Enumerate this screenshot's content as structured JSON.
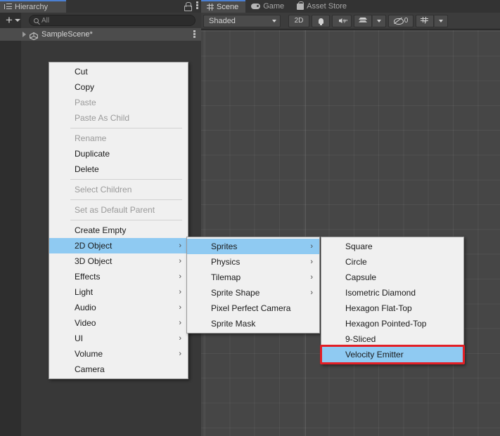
{
  "hierarchy": {
    "tab_label": "Hierarchy",
    "tab_icon": "hierarchy-icon",
    "lock_icon": "lock-icon",
    "more_icon": "kebab-menu-icon",
    "create_label": "+",
    "search_placeholder": "All",
    "search_value": "",
    "search_icon": "search-icon",
    "scene_item": "SampleScene*",
    "scene_icon": "unity-scene-icon"
  },
  "scene_view": {
    "tabs": [
      {
        "label": "Scene",
        "icon": "grid-icon",
        "active": true
      },
      {
        "label": "Game",
        "icon": "gamepad-icon",
        "active": false
      },
      {
        "label": "Asset Store",
        "icon": "store-bag-icon",
        "active": false
      }
    ],
    "toolbar": {
      "draw_mode": "Shaded",
      "draw_mode_icon": "chevron-down-icon",
      "two_d_label": "2D",
      "lighting_icon": "lightbulb-icon",
      "audio_icon": "speaker-icon",
      "fx_icon": "effects-layers-icon",
      "fx_caret_icon": "chevron-down-icon",
      "hidden_count": "0",
      "hidden_icon": "eye-off-icon",
      "gizmos_icon": "gizmos-icon",
      "gizmos_caret_icon": "chevron-down-icon"
    }
  },
  "menu1": {
    "name": "hierarchy-context-menu",
    "items": [
      {
        "label": "Cut",
        "state": "enabled",
        "submenu": false
      },
      {
        "label": "Copy",
        "state": "enabled",
        "submenu": false
      },
      {
        "label": "Paste",
        "state": "disabled",
        "submenu": false
      },
      {
        "label": "Paste As Child",
        "state": "disabled",
        "submenu": false
      },
      {
        "separator": true
      },
      {
        "label": "Rename",
        "state": "disabled",
        "submenu": false
      },
      {
        "label": "Duplicate",
        "state": "enabled",
        "submenu": false
      },
      {
        "label": "Delete",
        "state": "enabled",
        "submenu": false
      },
      {
        "separator": true
      },
      {
        "label": "Select Children",
        "state": "disabled",
        "submenu": false
      },
      {
        "separator": true
      },
      {
        "label": "Set as Default Parent",
        "state": "disabled",
        "submenu": false
      },
      {
        "separator": true
      },
      {
        "label": "Create Empty",
        "state": "enabled",
        "submenu": false
      },
      {
        "label": "2D Object",
        "state": "selected",
        "submenu": true
      },
      {
        "label": "3D Object",
        "state": "enabled",
        "submenu": true
      },
      {
        "label": "Effects",
        "state": "enabled",
        "submenu": true
      },
      {
        "label": "Light",
        "state": "enabled",
        "submenu": true
      },
      {
        "label": "Audio",
        "state": "enabled",
        "submenu": true
      },
      {
        "label": "Video",
        "state": "enabled",
        "submenu": true
      },
      {
        "label": "UI",
        "state": "enabled",
        "submenu": true
      },
      {
        "label": "Volume",
        "state": "enabled",
        "submenu": true
      },
      {
        "label": "Camera",
        "state": "enabled",
        "submenu": false
      }
    ]
  },
  "menu2": {
    "name": "2d-object-submenu",
    "items": [
      {
        "label": "Sprites",
        "state": "selected",
        "submenu": true
      },
      {
        "label": "Physics",
        "state": "enabled",
        "submenu": true
      },
      {
        "label": "Tilemap",
        "state": "enabled",
        "submenu": true
      },
      {
        "label": "Sprite Shape",
        "state": "enabled",
        "submenu": true
      },
      {
        "label": "Pixel Perfect Camera",
        "state": "enabled",
        "submenu": false
      },
      {
        "label": "Sprite Mask",
        "state": "enabled",
        "submenu": false
      }
    ]
  },
  "menu3": {
    "name": "sprites-submenu",
    "items": [
      {
        "label": "Square",
        "state": "enabled",
        "submenu": false
      },
      {
        "label": "Circle",
        "state": "enabled",
        "submenu": false
      },
      {
        "label": "Capsule",
        "state": "enabled",
        "submenu": false
      },
      {
        "label": "Isometric Diamond",
        "state": "enabled",
        "submenu": false
      },
      {
        "label": "Hexagon Flat-Top",
        "state": "enabled",
        "submenu": false
      },
      {
        "label": "Hexagon Pointed-Top",
        "state": "enabled",
        "submenu": false
      },
      {
        "label": "9-Sliced",
        "state": "enabled",
        "submenu": false
      },
      {
        "label": "Velocity Emitter",
        "state": "selected",
        "submenu": false
      }
    ],
    "highlight": {
      "target": "Velocity Emitter",
      "color": "#e31f26"
    }
  },
  "colors": {
    "accent_selection": "#8fcaf2",
    "highlight_border": "#e31f26",
    "menu_bg": "#f0f0f0",
    "panel_bg": "#383838",
    "tab_active_underline": "#4b7fd1"
  }
}
